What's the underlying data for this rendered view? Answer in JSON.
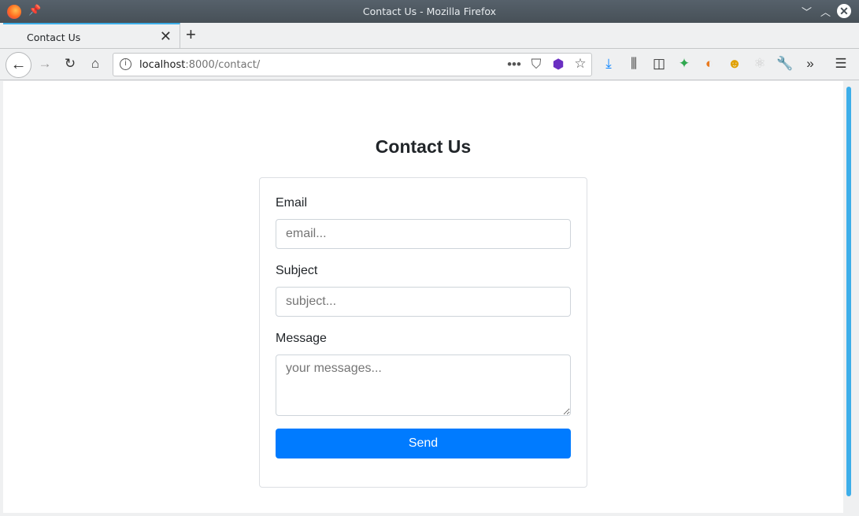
{
  "window": {
    "title": "Contact Us - Mozilla Firefox"
  },
  "tab": {
    "label": "Contact Us"
  },
  "url": {
    "host": "localhost",
    "rest": ":8000/contact/"
  },
  "page": {
    "title": "Contact Us",
    "email_label": "Email",
    "email_placeholder": "email...",
    "subject_label": "Subject",
    "subject_placeholder": "subject...",
    "message_label": "Message",
    "message_placeholder": "your messages...",
    "send_label": "Send"
  },
  "colors": {
    "accent": "#007bff",
    "tab_highlight": "#3daee9"
  }
}
